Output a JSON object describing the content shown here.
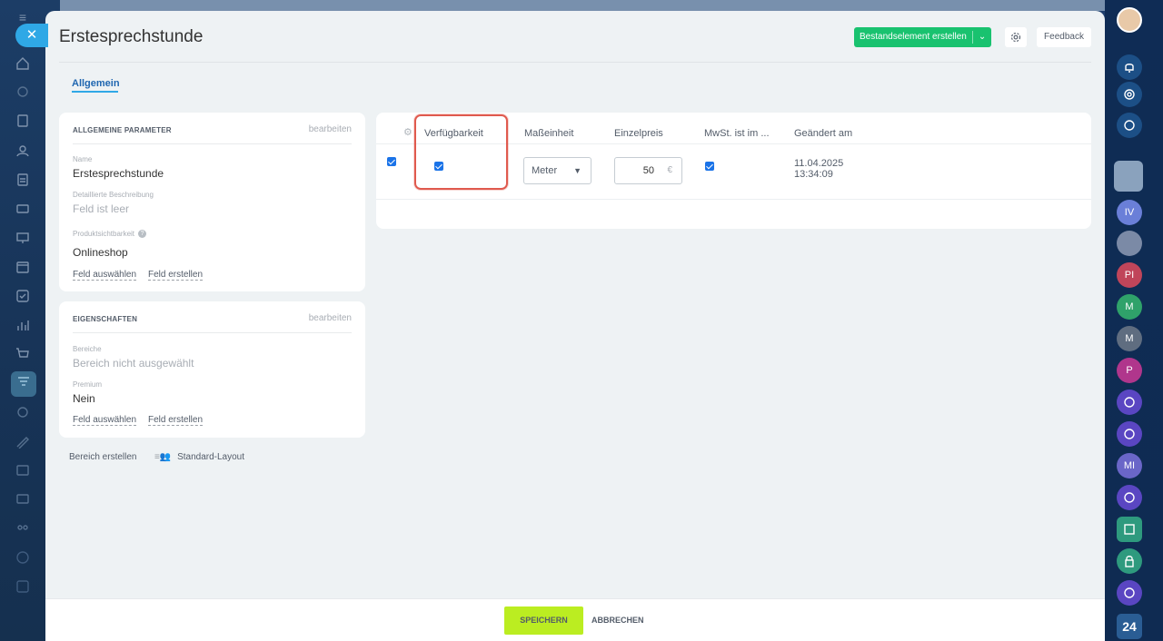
{
  "header": {
    "title": "Erstesprechstunde",
    "create_button": "Bestandselement erstellen",
    "feedback_button": "Feedback"
  },
  "tabs": [
    {
      "label": "Allgemein"
    }
  ],
  "general_params": {
    "heading": "ALLGEMEINE PARAMETER",
    "edit": "bearbeiten",
    "name_label": "Name",
    "name_value": "Erstesprechstunde",
    "desc_label": "Detaillierte Beschreibung",
    "desc_value": "Feld ist leer",
    "visibility_label": "Produktsichtbarkeit",
    "visibility_value": "Onlineshop",
    "select_field": "Feld auswählen",
    "create_field": "Feld erstellen"
  },
  "properties": {
    "heading": "EIGENSCHAFTEN",
    "edit": "bearbeiten",
    "areas_label": "Bereiche",
    "areas_value": "Bereich nicht ausgewählt",
    "premium_label": "Premium",
    "premium_value": "Nein",
    "select_field": "Feld auswählen",
    "create_field": "Feld erstellen"
  },
  "bottom_links": {
    "create_area": "Bereich erstellen",
    "standard_layout": "Standard-Layout"
  },
  "table": {
    "columns": [
      "Verfügbarkeit",
      "Maßeinheit",
      "Einzelpreis",
      "MwSt. ist im ...",
      "Geändert am"
    ],
    "row": {
      "selected": true,
      "available": true,
      "unit": "Meter",
      "price": "50",
      "currency": "€",
      "vat_included": true,
      "changed_date": "11.04.2025",
      "changed_time": "13:34:09"
    }
  },
  "footer": {
    "save": "SPEICHERN",
    "cancel": "ABBRECHEN"
  },
  "right_bar": {
    "avatars": [
      "IV",
      "PI",
      "M",
      "M",
      "P",
      "MI"
    ],
    "logo": "24"
  },
  "colors": {
    "primary_green": "#19c26f",
    "save_green": "#bbed21",
    "accent_blue": "#2fa8e6",
    "highlight_red": "#e05a4e"
  }
}
